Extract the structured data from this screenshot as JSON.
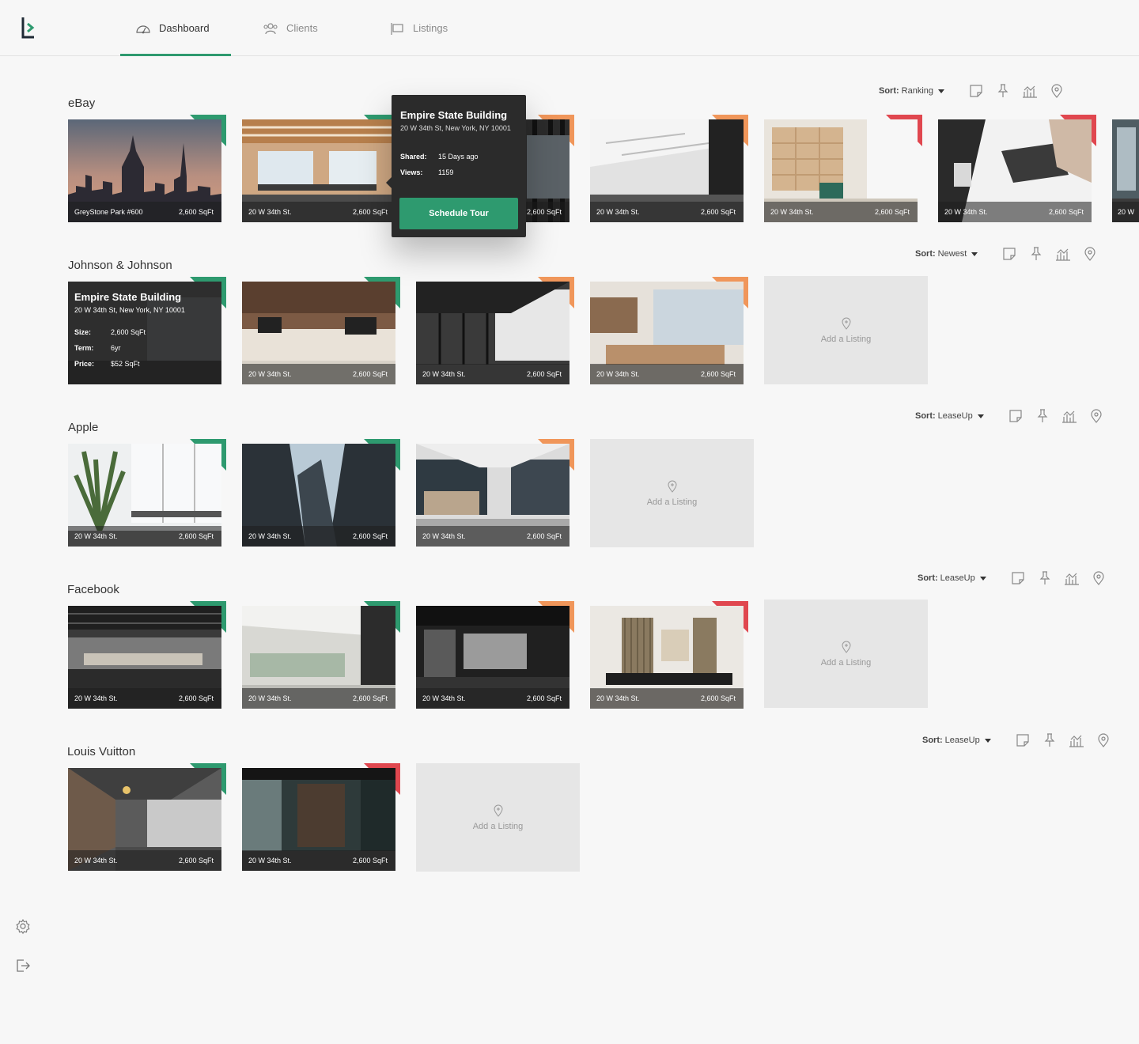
{
  "nav": {
    "tabs": [
      {
        "label": "Dashboard",
        "icon": "speedometer-icon",
        "active": true
      },
      {
        "label": "Clients",
        "icon": "users-icon",
        "active": false
      },
      {
        "label": "Listings",
        "icon": "flag-icon",
        "active": false
      }
    ]
  },
  "colors": {
    "green": "#2e9a6f",
    "orange": "#f0965a",
    "red": "#e0474f",
    "accent": "#2e9a6f"
  },
  "add_listing_label": "Add a Listing",
  "tooltip": {
    "title": "Empire State Building",
    "address": "20 W 34th St, New York, NY 10001",
    "shared_label": "Shared:",
    "shared_value": "15 Days ago",
    "views_label": "Views:",
    "views_value": "1159",
    "button": "Schedule Tour"
  },
  "info_overlay": {
    "title": "Empire State Building",
    "address": "20 W 34th St, New York, NY 10001",
    "size_label": "Size:",
    "size_value": "2,600 SqFt",
    "term_label": "Term:",
    "term_value": "6yr",
    "price_label": "Price:",
    "price_value": "$52 SqFt"
  },
  "sections": [
    {
      "client": "eBay",
      "sort_label": "Sort:",
      "sort_value": "Ranking",
      "cards": [
        {
          "address": "GreyStone Park #600",
          "size": "2,600 SqFt",
          "tag": "green"
        },
        {
          "address": "20 W 34th St.",
          "size": "2,600 SqFt",
          "tag": "green"
        },
        {
          "address": "",
          "size": "2,600 SqFt",
          "tag": "orange"
        },
        {
          "address": "20 W 34th St.",
          "size": "2,600 SqFt",
          "tag": "orange"
        },
        {
          "address": "20 W 34th St.",
          "size": "2,600 SqFt",
          "tag": "red"
        },
        {
          "address": "20 W 34th St.",
          "size": "2,600 SqFt",
          "tag": "red"
        },
        {
          "address": "20 W",
          "size": "",
          "tag": "none"
        }
      ]
    },
    {
      "client": "Johnson & Johnson",
      "sort_label": "Sort:",
      "sort_value": "Newest",
      "cards": [
        {
          "address": "",
          "size": "",
          "tag": "green"
        },
        {
          "address": "20 W 34th St.",
          "size": "2,600 SqFt",
          "tag": "green"
        },
        {
          "address": "20 W 34th St.",
          "size": "2,600 SqFt",
          "tag": "orange"
        },
        {
          "address": "20 W 34th St.",
          "size": "2,600 SqFt",
          "tag": "orange"
        }
      ]
    },
    {
      "client": "Apple",
      "sort_label": "Sort:",
      "sort_value": "LeaseUp",
      "cards": [
        {
          "address": "20 W 34th St.",
          "size": "2,600 SqFt",
          "tag": "green"
        },
        {
          "address": "20 W 34th St.",
          "size": "2,600 SqFt",
          "tag": "green"
        },
        {
          "address": "20 W 34th St.",
          "size": "2,600 SqFt",
          "tag": "orange"
        }
      ]
    },
    {
      "client": "Facebook",
      "sort_label": "Sort:",
      "sort_value": "LeaseUp",
      "cards": [
        {
          "address": "20 W 34th St.",
          "size": "2,600 SqFt",
          "tag": "green"
        },
        {
          "address": "20 W 34th St.",
          "size": "2,600 SqFt",
          "tag": "green"
        },
        {
          "address": "20 W 34th St.",
          "size": "2,600 SqFt",
          "tag": "orange"
        },
        {
          "address": "20 W 34th St.",
          "size": "2,600 SqFt",
          "tag": "red"
        }
      ]
    },
    {
      "client": "Louis Vuitton",
      "sort_label": "Sort:",
      "sort_value": "LeaseUp",
      "cards": [
        {
          "address": "20 W 34th St.",
          "size": "2,600 SqFt",
          "tag": "green"
        },
        {
          "address": "20 W 34th St.",
          "size": "2,600 SqFt",
          "tag": "red"
        }
      ]
    }
  ]
}
